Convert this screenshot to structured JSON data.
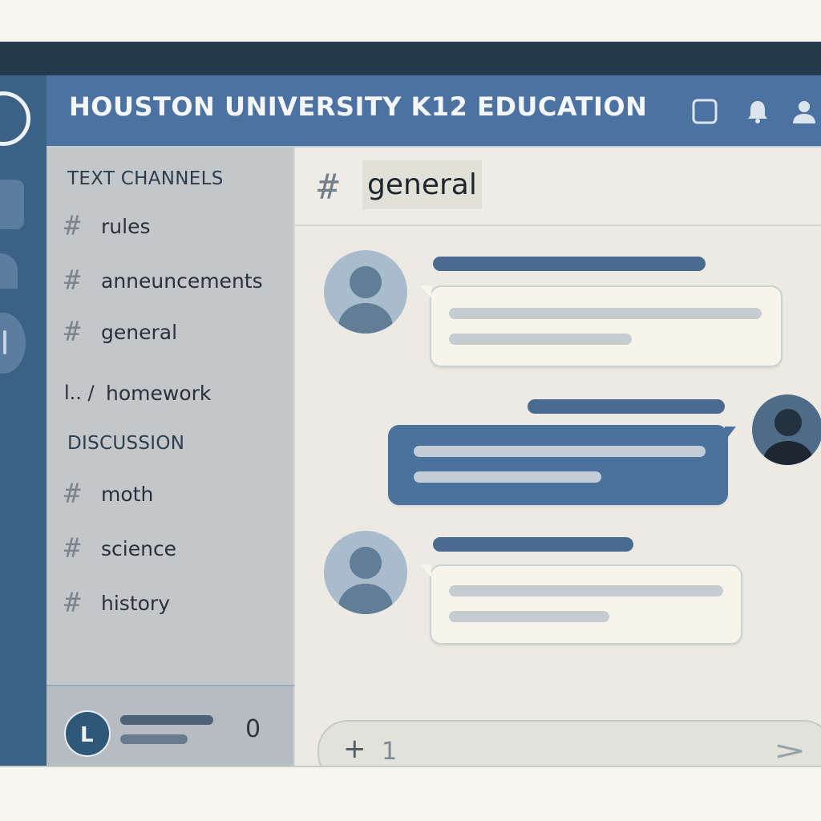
{
  "server": {
    "title": "HOUSTON UNIVERSITY K12 EDUCATION"
  },
  "header_icons": [
    "square-icon",
    "bell-icon",
    "user-icon"
  ],
  "sidebar": {
    "categories": [
      {
        "label": "TEXT CHANNELS",
        "channels": [
          {
            "prefix": "#",
            "name": "rules"
          },
          {
            "prefix": "#",
            "name": "anneuncements"
          },
          {
            "prefix": "#",
            "name": "general"
          },
          {
            "prefix": "l.. /",
            "name": "homework"
          }
        ]
      },
      {
        "label": "DISCUSSION",
        "channels": [
          {
            "prefix": "#",
            "name": "moth"
          },
          {
            "prefix": "#",
            "name": "science"
          },
          {
            "prefix": "#",
            "name": "history"
          }
        ]
      }
    ]
  },
  "user_panel": {
    "avatar_letter": "L",
    "status_glyph": "0"
  },
  "channel": {
    "hash": "#",
    "name": "general"
  },
  "composer": {
    "plus": "+",
    "value": "1"
  },
  "colors": {
    "accent": "#4b72a0",
    "dark": "#253a4c",
    "sidebar": "#c3c7ca",
    "chat_bg": "#eceae3"
  }
}
